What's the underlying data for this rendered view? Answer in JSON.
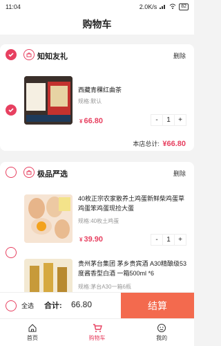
{
  "status": {
    "time": "11:04",
    "speed": "2.0K/s",
    "battery": "82"
  },
  "header": {
    "title": "购物车"
  },
  "stores": [
    {
      "name": "知知友礼",
      "delete_label": "删除",
      "checked": true,
      "items": [
        {
          "title": "西藏青稞红曲茶",
          "spec": "规格:默认",
          "currency": "¥",
          "price": "66.80",
          "qty": "1"
        }
      ],
      "total_label": "本店总计:",
      "total_value": "¥66.80"
    },
    {
      "name": "极品严选",
      "delete_label": "删除",
      "checked": false,
      "items": [
        {
          "title": "40枚正宗农家散养土鸡蛋新鲜柴鸡蛋草鸡蛋笨鸡蛋现捡大蛋",
          "spec": "规格:40枚土鸡蛋",
          "currency": "¥",
          "price": "39.90",
          "qty": "1"
        },
        {
          "title": "贵州茅台集团 茅乡贵宾酒 A30精酿级53度酱香型白酒 一箱500ml *6",
          "spec": "规格:茅台A30一箱6瓶"
        }
      ]
    }
  ],
  "stepper": {
    "minus": "-",
    "plus": "+"
  },
  "bottom": {
    "select_all": "全选",
    "total_label": "合计:",
    "total_value": "66.80",
    "checkout": "结算"
  },
  "tabs": [
    {
      "label": "首页",
      "icon": "home-icon"
    },
    {
      "label": "购物车",
      "icon": "cart-icon",
      "active": true
    },
    {
      "label": "我的",
      "icon": "profile-icon"
    }
  ],
  "colors": {
    "accent": "#e74060",
    "checkout": "#f36a4e"
  }
}
